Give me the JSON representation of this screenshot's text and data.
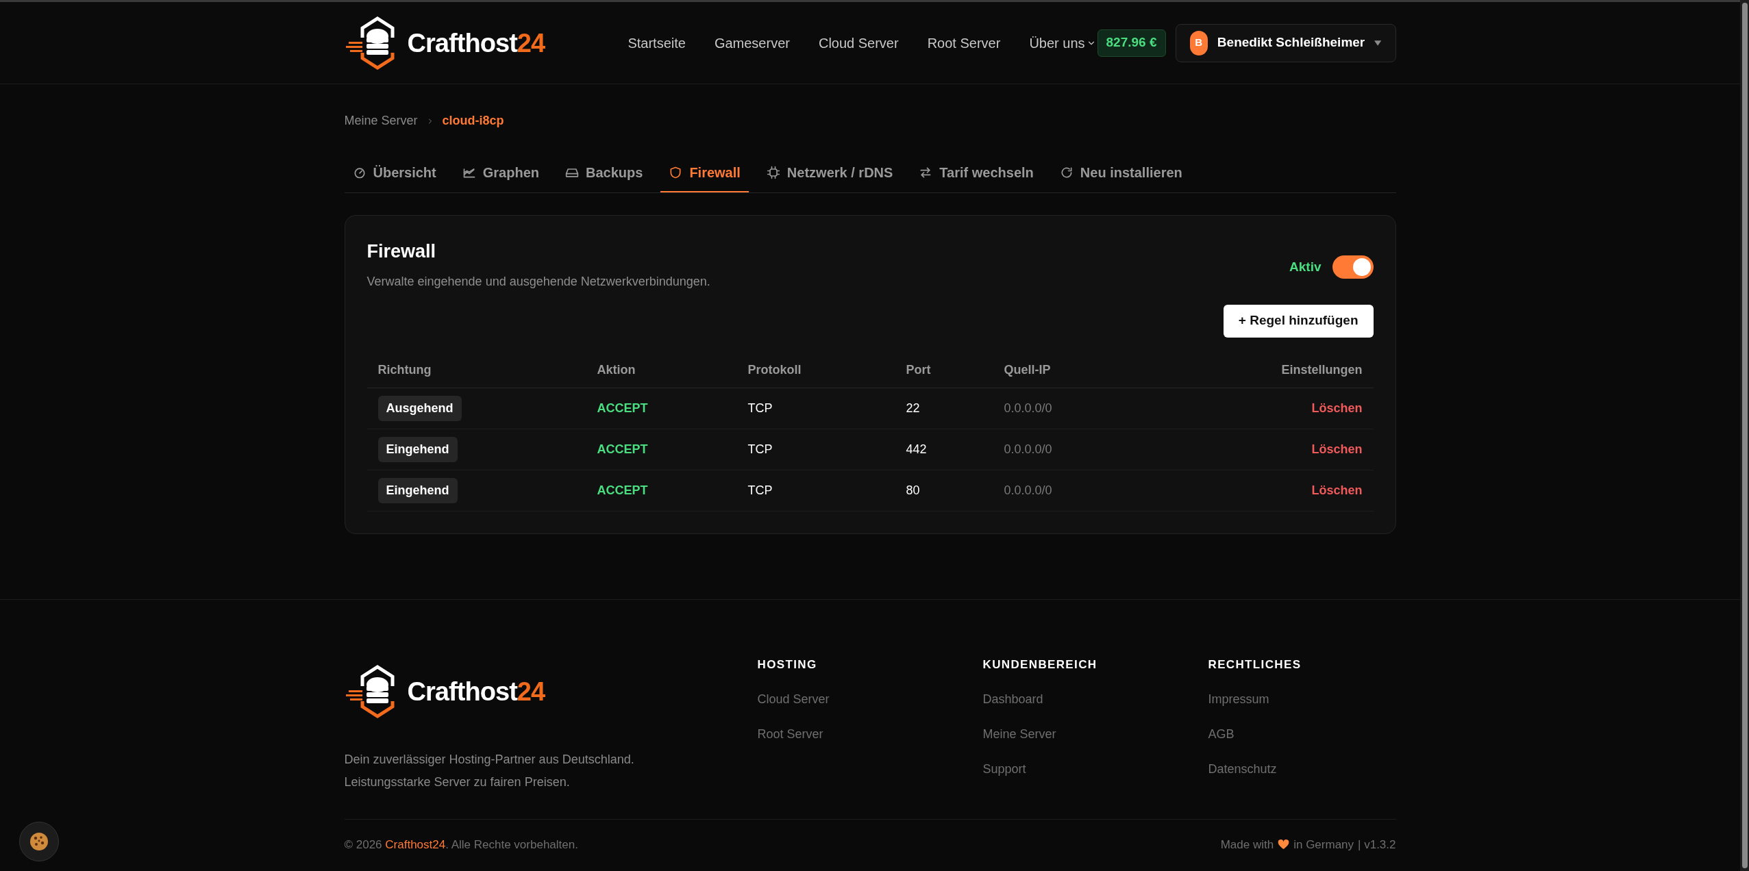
{
  "header": {
    "logo": {
      "text": "Crafthost",
      "accent": "24"
    },
    "nav": [
      {
        "label": "Startseite",
        "dropdown": false
      },
      {
        "label": "Gameserver",
        "dropdown": false
      },
      {
        "label": "Cloud Server",
        "dropdown": false
      },
      {
        "label": "Root Server",
        "dropdown": false
      },
      {
        "label": "Über uns",
        "dropdown": true
      }
    ],
    "balance": "827.96 €",
    "user": {
      "initial": "B",
      "name": "Benedikt Schleißheimer"
    }
  },
  "breadcrumb": [
    {
      "label": "Meine Server",
      "current": false
    },
    {
      "label": "cloud-i8cp",
      "current": true
    }
  ],
  "tabs": [
    {
      "label": "Übersicht",
      "kind": "gauge",
      "selected": false
    },
    {
      "label": "Graphen",
      "kind": "chart",
      "selected": false
    },
    {
      "label": "Backups",
      "kind": "drive",
      "selected": false
    },
    {
      "label": "Firewall",
      "kind": "shield",
      "selected": true
    },
    {
      "label": "Netzwerk / rDNS",
      "kind": "chip",
      "selected": false
    },
    {
      "label": "Tarif wechseln",
      "kind": "swap",
      "selected": false
    },
    {
      "label": "Neu installieren",
      "kind": "refresh",
      "selected": false
    }
  ],
  "firewall": {
    "title": "Firewall",
    "subtitle": "Verwalte eingehende und ausgehende Netzwerkverbindungen.",
    "status_label": "Aktiv",
    "enabled": true,
    "add_button": "+ Regel hinzufügen"
  },
  "table": {
    "columns": [
      "Richtung",
      "Aktion",
      "Protokoll",
      "Port",
      "Quell-IP",
      "Einstellungen"
    ],
    "rows": [
      {
        "direction": "Ausgehend",
        "action": "ACCEPT",
        "protocol": "TCP",
        "port": "22",
        "source_ip": "0.0.0.0/0",
        "delete": "Löschen"
      },
      {
        "direction": "Eingehend",
        "action": "ACCEPT",
        "protocol": "TCP",
        "port": "442",
        "source_ip": "0.0.0.0/0",
        "delete": "Löschen"
      },
      {
        "direction": "Eingehend",
        "action": "ACCEPT",
        "protocol": "TCP",
        "port": "80",
        "source_ip": "0.0.0.0/0",
        "delete": "Löschen"
      }
    ]
  },
  "footer": {
    "logo": {
      "text": "Crafthost",
      "accent": "24"
    },
    "tagline": [
      "Dein zuverlässiger Hosting-Partner aus Deutschland.",
      "Leistungsstarke Server zu fairen Preisen."
    ],
    "columns": [
      {
        "heading": "HOSTING",
        "links": [
          "Cloud Server",
          "Root Server"
        ]
      },
      {
        "heading": "KUNDENBEREICH",
        "links": [
          "Dashboard",
          "Meine Server",
          "Support"
        ]
      },
      {
        "heading": "RECHTLICHES",
        "links": [
          "Impressum",
          "AGB",
          "Datenschutz"
        ]
      }
    ],
    "copyright": {
      "before": "© 2026 ",
      "link": "Crafthost24",
      "after": ". Alle Rechte vorbehalten."
    },
    "made_with": "Made with",
    "made_in": "in Germany",
    "version": "| v1.3.2"
  }
}
